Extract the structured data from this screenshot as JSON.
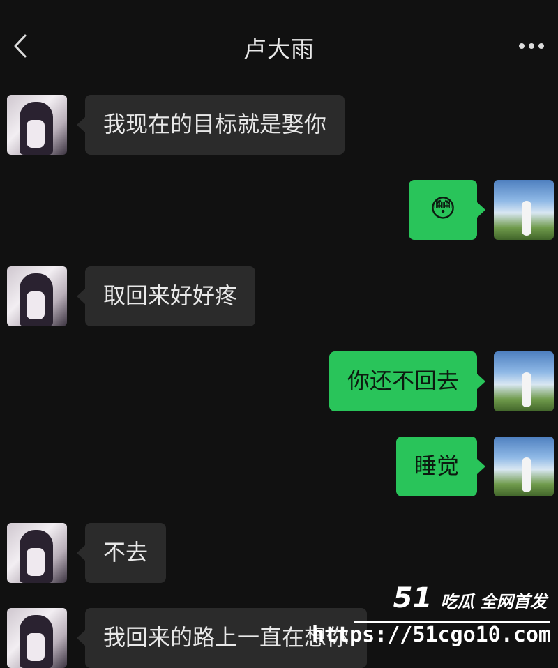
{
  "header": {
    "title": "卢大雨",
    "back_icon": "chevron-left-icon",
    "more_icon": "more-horizontal-icon"
  },
  "messages": [
    {
      "side": "left",
      "text": "我现在的目标就是娶你"
    },
    {
      "side": "right",
      "text": "😳",
      "type": "emoji"
    },
    {
      "side": "left",
      "text": "取回来好好疼"
    },
    {
      "side": "right",
      "text": "你还不回去"
    },
    {
      "side": "right",
      "text": "睡觉"
    },
    {
      "side": "left",
      "text": "不去"
    },
    {
      "side": "left",
      "text": "我回来的路上一直在想你"
    }
  ],
  "watermark": {
    "brand_number": "51",
    "brand_text": "吃瓜 全网首发",
    "url": "https://51cgo10.com"
  },
  "colors": {
    "background": "#111111",
    "incoming_bubble": "#2b2b2b",
    "outgoing_bubble": "#29c45a",
    "text_light": "#e8e8e8"
  }
}
